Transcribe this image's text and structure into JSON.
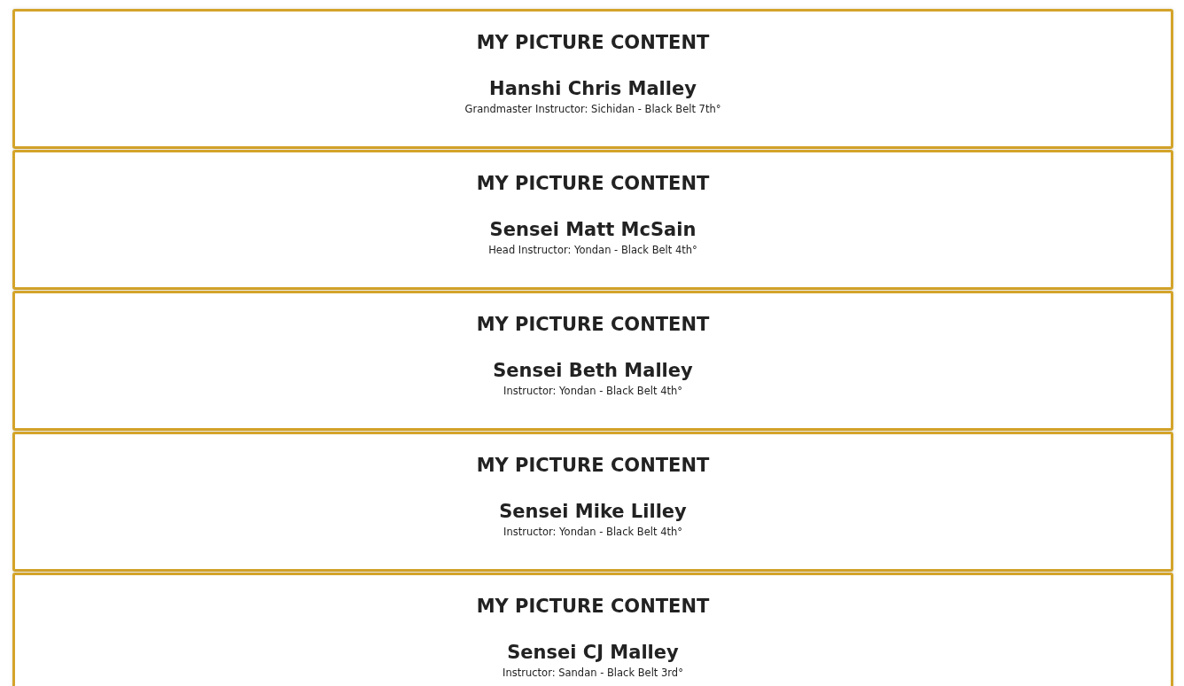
{
  "cards": [
    {
      "heading": "MY PICTURE CONTENT",
      "name": "Hanshi Chris Malley",
      "title": "Grandmaster Instructor: Sichidan - Black Belt 7th°"
    },
    {
      "heading": "MY PICTURE CONTENT",
      "name": "Sensei Matt McSain",
      "title": "Head Instructor: Yondan - Black Belt 4th°"
    },
    {
      "heading": "MY PICTURE CONTENT",
      "name": "Sensei Beth Malley",
      "title": "Instructor: Yondan - Black Belt 4th°"
    },
    {
      "heading": "MY PICTURE CONTENT",
      "name": "Sensei Mike Lilley",
      "title": "Instructor: Yondan - Black Belt 4th°"
    },
    {
      "heading": "MY PICTURE CONTENT",
      "name": "Sensei CJ Malley",
      "title": "Instructor: Sandan - Black Belt 3rd°"
    }
  ]
}
